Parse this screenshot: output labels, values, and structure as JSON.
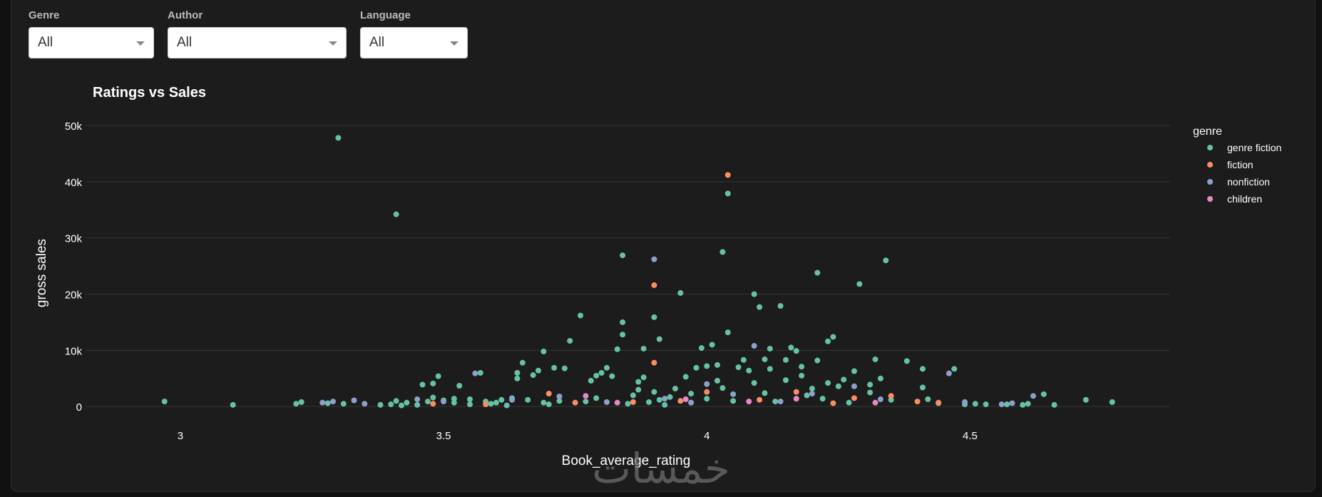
{
  "filters": {
    "genre": {
      "label": "Genre",
      "value": "All"
    },
    "author": {
      "label": "Author",
      "value": "All"
    },
    "language": {
      "label": "Language",
      "value": "All"
    }
  },
  "watermark": "خمسات",
  "chart_data": {
    "type": "scatter",
    "title": "Ratings vs Sales",
    "xlabel": "Book_average_rating",
    "ylabel": "gross sales",
    "xlim": [
      2.82,
      4.88
    ],
    "ylim": [
      -1500,
      50000
    ],
    "xticks": [
      3,
      3.5,
      4,
      4.5
    ],
    "xtick_labels": [
      "3",
      "3.5",
      "4",
      "4.5"
    ],
    "yticks": [
      0,
      10000,
      20000,
      30000,
      40000,
      50000
    ],
    "ytick_labels": [
      "0",
      "10k",
      "20k",
      "30k",
      "40k",
      "50k"
    ],
    "grid": "horizontal",
    "legend": {
      "title": "genre",
      "position": "right"
    },
    "series": [
      {
        "name": "genre fiction",
        "color": "#66c2a5",
        "points": [
          [
            2.97,
            900
          ],
          [
            3.1,
            300
          ],
          [
            3.22,
            500
          ],
          [
            3.23,
            800
          ],
          [
            3.28,
            600
          ],
          [
            3.3,
            47800
          ],
          [
            3.31,
            500
          ],
          [
            3.38,
            300
          ],
          [
            3.4,
            400
          ],
          [
            3.41,
            1000
          ],
          [
            3.41,
            34200
          ],
          [
            3.42,
            200
          ],
          [
            3.43,
            700
          ],
          [
            3.45,
            300
          ],
          [
            3.46,
            3900
          ],
          [
            3.47,
            900
          ],
          [
            3.48,
            1600
          ],
          [
            3.48,
            4100
          ],
          [
            3.49,
            5400
          ],
          [
            3.5,
            1100
          ],
          [
            3.52,
            700
          ],
          [
            3.52,
            1400
          ],
          [
            3.53,
            3700
          ],
          [
            3.55,
            1300
          ],
          [
            3.55,
            400
          ],
          [
            3.57,
            6000
          ],
          [
            3.58,
            900
          ],
          [
            3.59,
            500
          ],
          [
            3.6,
            700
          ],
          [
            3.61,
            1200
          ],
          [
            3.62,
            200
          ],
          [
            3.63,
            1500
          ],
          [
            3.64,
            5000
          ],
          [
            3.64,
            6000
          ],
          [
            3.65,
            7800
          ],
          [
            3.66,
            1200
          ],
          [
            3.67,
            5600
          ],
          [
            3.68,
            6400
          ],
          [
            3.69,
            700
          ],
          [
            3.69,
            9800
          ],
          [
            3.7,
            400
          ],
          [
            3.71,
            6900
          ],
          [
            3.72,
            1000
          ],
          [
            3.73,
            6800
          ],
          [
            3.74,
            11700
          ],
          [
            3.76,
            16200
          ],
          [
            3.77,
            900
          ],
          [
            3.78,
            4600
          ],
          [
            3.79,
            1500
          ],
          [
            3.79,
            5500
          ],
          [
            3.8,
            6000
          ],
          [
            3.81,
            6900
          ],
          [
            3.82,
            5400
          ],
          [
            3.83,
            10200
          ],
          [
            3.84,
            12800
          ],
          [
            3.84,
            26900
          ],
          [
            3.84,
            15000
          ],
          [
            3.85,
            500
          ],
          [
            3.86,
            2000
          ],
          [
            3.87,
            4400
          ],
          [
            3.87,
            3000
          ],
          [
            3.88,
            5200
          ],
          [
            3.88,
            10300
          ],
          [
            3.89,
            800
          ],
          [
            3.9,
            2600
          ],
          [
            3.9,
            15900
          ],
          [
            3.91,
            1200
          ],
          [
            3.91,
            12000
          ],
          [
            3.92,
            300
          ],
          [
            3.93,
            1700
          ],
          [
            3.94,
            3200
          ],
          [
            3.95,
            20200
          ],
          [
            3.96,
            5300
          ],
          [
            3.97,
            700
          ],
          [
            3.97,
            2300
          ],
          [
            3.98,
            6900
          ],
          [
            3.99,
            10400
          ],
          [
            4.0,
            7200
          ],
          [
            4.0,
            1400
          ],
          [
            4.01,
            11000
          ],
          [
            4.02,
            7400
          ],
          [
            4.02,
            4600
          ],
          [
            4.03,
            3300
          ],
          [
            4.03,
            27500
          ],
          [
            4.04,
            13200
          ],
          [
            4.04,
            37900
          ],
          [
            4.05,
            1000
          ],
          [
            4.06,
            7000
          ],
          [
            4.07,
            8300
          ],
          [
            4.08,
            6400
          ],
          [
            4.09,
            4200
          ],
          [
            4.09,
            20000
          ],
          [
            4.1,
            17700
          ],
          [
            4.11,
            2400
          ],
          [
            4.11,
            8400
          ],
          [
            4.12,
            10300
          ],
          [
            4.12,
            6700
          ],
          [
            4.13,
            900
          ],
          [
            4.14,
            17900
          ],
          [
            4.15,
            4700
          ],
          [
            4.15,
            8300
          ],
          [
            4.16,
            10500
          ],
          [
            4.17,
            9900
          ],
          [
            4.18,
            5500
          ],
          [
            4.18,
            7100
          ],
          [
            4.19,
            2000
          ],
          [
            4.2,
            3200
          ],
          [
            4.21,
            8200
          ],
          [
            4.21,
            23800
          ],
          [
            4.22,
            1400
          ],
          [
            4.23,
            4200
          ],
          [
            4.23,
            11600
          ],
          [
            4.24,
            12400
          ],
          [
            4.25,
            3600
          ],
          [
            4.26,
            4800
          ],
          [
            4.27,
            700
          ],
          [
            4.28,
            6300
          ],
          [
            4.29,
            21800
          ],
          [
            4.31,
            3900
          ],
          [
            4.31,
            2500
          ],
          [
            4.32,
            8400
          ],
          [
            4.33,
            5000
          ],
          [
            4.34,
            26000
          ],
          [
            4.35,
            1200
          ],
          [
            4.38,
            8100
          ],
          [
            4.41,
            6700
          ],
          [
            4.41,
            3400
          ],
          [
            4.42,
            1300
          ],
          [
            4.44,
            600
          ],
          [
            4.47,
            6700
          ],
          [
            4.49,
            400
          ],
          [
            4.51,
            500
          ],
          [
            4.53,
            400
          ],
          [
            4.57,
            400
          ],
          [
            4.6,
            300
          ],
          [
            4.61,
            500
          ],
          [
            4.64,
            2200
          ],
          [
            4.66,
            300
          ],
          [
            4.72,
            1200
          ],
          [
            4.77,
            800
          ]
        ]
      },
      {
        "name": "fiction",
        "color": "#fc8d62",
        "points": [
          [
            3.48,
            500
          ],
          [
            3.58,
            400
          ],
          [
            3.7,
            2300
          ],
          [
            3.75,
            700
          ],
          [
            3.86,
            800
          ],
          [
            3.9,
            21600
          ],
          [
            3.9,
            7800
          ],
          [
            3.95,
            1000
          ],
          [
            4.0,
            2600
          ],
          [
            4.04,
            41200
          ],
          [
            4.1,
            1200
          ],
          [
            4.17,
            2600
          ],
          [
            4.24,
            600
          ],
          [
            4.28,
            1500
          ],
          [
            4.35,
            1900
          ],
          [
            4.4,
            900
          ],
          [
            4.44,
            700
          ]
        ]
      },
      {
        "name": "nonfiction",
        "color": "#8da0cb",
        "points": [
          [
            3.27,
            700
          ],
          [
            3.29,
            900
          ],
          [
            3.33,
            1100
          ],
          [
            3.35,
            500
          ],
          [
            3.45,
            1300
          ],
          [
            3.5,
            900
          ],
          [
            3.56,
            5900
          ],
          [
            3.63,
            1200
          ],
          [
            3.72,
            1800
          ],
          [
            3.81,
            800
          ],
          [
            3.9,
            26200
          ],
          [
            3.92,
            1400
          ],
          [
            3.97,
            700
          ],
          [
            4.0,
            4000
          ],
          [
            4.05,
            2200
          ],
          [
            4.09,
            10800
          ],
          [
            4.14,
            900
          ],
          [
            4.2,
            2300
          ],
          [
            4.28,
            3600
          ],
          [
            4.33,
            1300
          ],
          [
            4.46,
            5900
          ],
          [
            4.49,
            800
          ],
          [
            4.56,
            400
          ],
          [
            4.58,
            600
          ],
          [
            4.62,
            1900
          ]
        ]
      },
      {
        "name": "children",
        "color": "#e78ac3",
        "points": [
          [
            3.77,
            1900
          ],
          [
            3.83,
            700
          ],
          [
            3.96,
            1300
          ],
          [
            4.08,
            900
          ],
          [
            4.17,
            1400
          ],
          [
            4.32,
            700
          ]
        ]
      }
    ]
  }
}
